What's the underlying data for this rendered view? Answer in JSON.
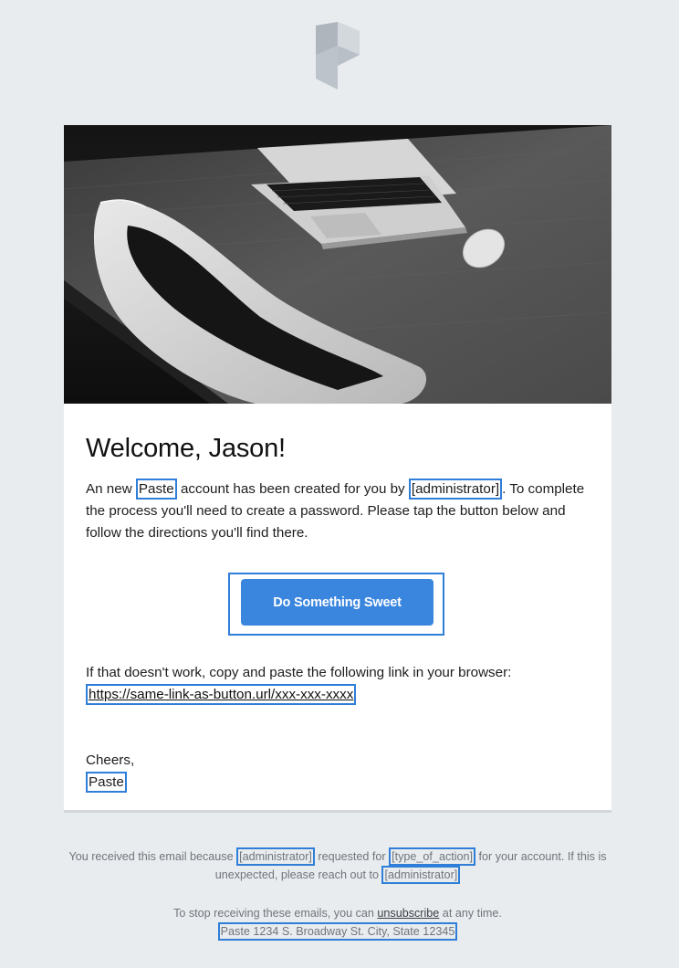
{
  "email": {
    "greeting": "Welcome, Jason!",
    "body": {
      "p1_a": "An new ",
      "product": "Paste",
      "p1_b": " account has been created for you by ",
      "creator": "[administrator]",
      "p1_c": ". To complete the process you'll need to create a password. Please tap the button below and follow the directions you'll find there."
    },
    "cta_label": "Do Something Sweet",
    "fallback_text": "If that doesn't work, copy and paste the following link in your browser:",
    "fallback_link": "https://same-link-as-button.url/xxx-xxx-xxxx",
    "signoff": "Cheers,",
    "sender": "Paste"
  },
  "footer": {
    "reason_a": "You received this email because ",
    "reason_actor": "[administrator]",
    "reason_b": " requested for ",
    "reason_action": "[type_of_action]",
    "reason_c": " for your account. If this is unexpected, please reach out to ",
    "reason_contact": "[administrator]",
    "unsub_a": "To stop receiving these emails, you can ",
    "unsub_link": "unsubscribe",
    "unsub_b": " at any time.",
    "address": "Paste 1234 S. Broadway St. City, State 12345"
  },
  "colors": {
    "page_bg": "#e9ecef",
    "button": "#3a86de",
    "highlight": "#2f7ed8"
  },
  "icons": {
    "logo": "paste-logo-icon",
    "hero": "laptop-desk-photo"
  }
}
